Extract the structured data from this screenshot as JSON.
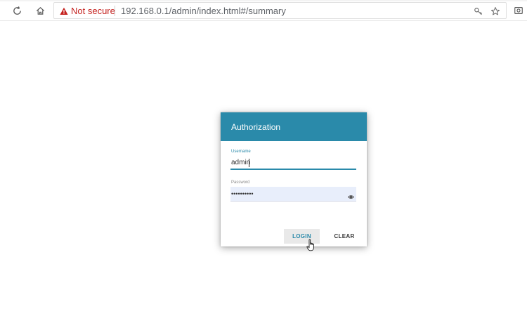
{
  "browser": {
    "security_label": "Not secure",
    "url": "192.168.0.1/admin/index.html#/summary",
    "icons": {
      "reload": "reload-icon",
      "home": "home-icon",
      "warning": "warning-icon",
      "key": "key-icon",
      "star": "star-icon",
      "extension": "extension-icon"
    }
  },
  "dialog": {
    "title": "Authorization",
    "username_label": "Username",
    "username_value": "admin",
    "password_label": "Password",
    "password_value": "••••••••••",
    "login_label": "LOGIN",
    "clear_label": "CLEAR"
  },
  "colors": {
    "accent": "#2a8aaa",
    "warning": "#c5221f",
    "password_bg": "#e8eefb"
  }
}
